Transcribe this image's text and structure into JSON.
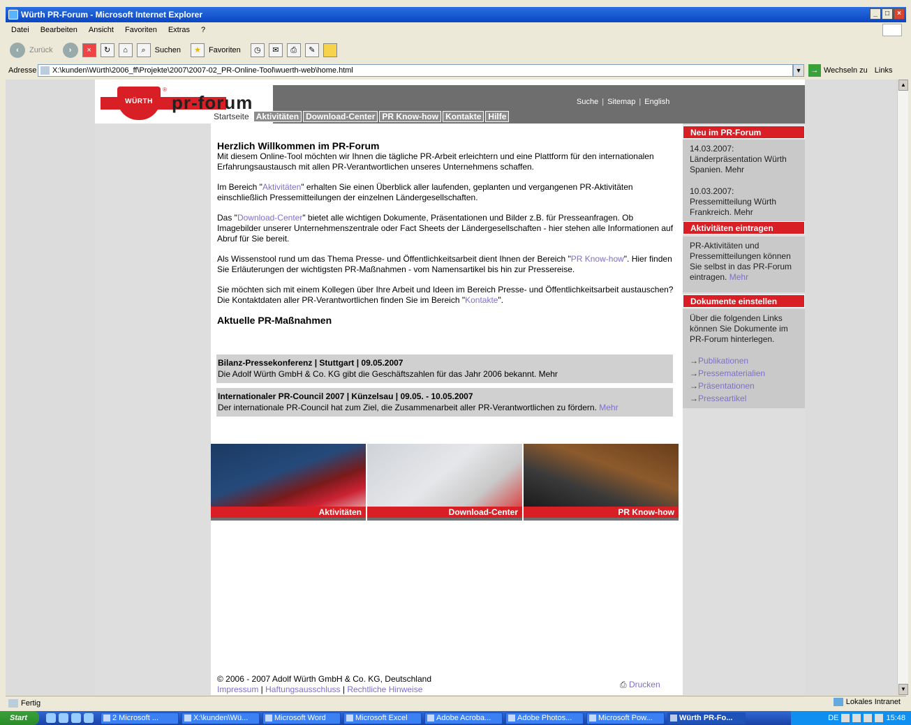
{
  "window": {
    "title": "Würth PR-Forum - Microsoft Internet Explorer"
  },
  "menu": [
    "Datei",
    "Bearbeiten",
    "Ansicht",
    "Favoriten",
    "Extras",
    "?"
  ],
  "toolbar": {
    "back": "Zurück",
    "search": "Suchen",
    "favorites": "Favoriten"
  },
  "address": {
    "label": "Adresse",
    "value": "X:\\kunden\\Würth\\2006_ff\\Projekte\\2007\\2007-02_PR-Online-Tool\\wuerth-web\\home.html",
    "go": "Wechseln zu",
    "links": "Links"
  },
  "header": {
    "logo_text": "WÜRTH",
    "brand": "pr-forum",
    "top_links": [
      "Suche",
      "Sitemap",
      "English"
    ]
  },
  "nav": [
    "Startseite",
    "Aktivitäten",
    "Download-Center",
    "PR Know-how",
    "Kontakte",
    "Hilfe"
  ],
  "main": {
    "heading": "Herzlich Willkommen im PR-Forum",
    "p1": "Mit diesem Online-Tool möchten wir Ihnen die tägliche PR-Arbeit erleichtern und eine Plattform für den internationalen Erfahrungsaustausch mit allen PR-Verantwortlichen unseres Unternehmens schaffen.",
    "p2_a": "Im Bereich \"",
    "p2_link": "Aktivitäten",
    "p2_b": "\" erhalten Sie einen Überblick aller laufenden, geplanten und vergangenen PR-Aktivitäten einschließlich Pressemitteilungen der einzelnen Ländergesellschaften.",
    "p3_a": "Das \"",
    "p3_link": "Download-Center",
    "p3_b": "\" bietet alle wichtigen Dokumente, Präsentationen und Bilder z.B. für Presseanfragen. Ob Imagebilder unserer Unternehmenszentrale oder Fact Sheets der Ländergesellschaften - hier stehen alle Informationen auf Abruf für Sie bereit.",
    "p4_a": "Als Wissenstool rund um das Thema Presse- und Öffentlichkeitsarbeit dient Ihnen der Bereich \"",
    "p4_link": "PR Know-how",
    "p4_b": "\". Hier finden Sie Erläuterungen der wichtigsten PR-Maßnahmen - vom Namensartikel bis hin zur Pressereise.",
    "p5_a": "Sie möchten sich mit einem Kollegen über Ihre Arbeit und Ideen im Bereich Presse- und Öffentlichkeitsarbeit austauschen? Die Kontaktdaten aller PR-Verantwortlichen finden Sie im Bereich \"",
    "p5_link": "Kontakte",
    "p5_b": "\".",
    "subheading": "Aktuelle PR-Maßnahmen"
  },
  "news": [
    {
      "title": "Bilanz-Pressekonferenz | Stuttgart | 09.05.2007",
      "text": "Die Adolf Würth GmbH & Co. KG gibt die Geschäftszahlen für das Jahr 2006 bekannt. Mehr",
      "more": ""
    },
    {
      "title": "Internationaler PR-Council 2007 | Künzelsau | 09.05. - 10.05.2007",
      "text": "Der internationale PR-Council hat zum Ziel, die Zusammenarbeit aller PR-Verantwortlichen zu fördern.",
      "more": "Mehr"
    }
  ],
  "banners": [
    "Aktivitäten",
    "Download-Center",
    "PR Know-how"
  ],
  "sidebar": {
    "box1": {
      "title": "Neu im PR-Forum",
      "item1_date": "14.03.2007:",
      "item1_text": "Länderpräsentation Würth Spanien. Mehr",
      "item2_date": "10.03.2007:",
      "item2_text": "Pressemitteilung Würth Frankreich. Mehr"
    },
    "box2": {
      "title": "Aktivitäten eintragen",
      "text": "PR-Aktivitäten und Pressemitteilungen können Sie selbst in das PR-Forum eintragen.",
      "more": "Mehr"
    },
    "box3": {
      "title": "Dokumente einstellen",
      "text": "Über die folgenden Links können Sie Dokumente im PR-Forum hinterlegen.",
      "links": [
        "Publikationen",
        "Pressematerialien",
        "Präsentationen",
        "Presseartikel"
      ]
    }
  },
  "footer": {
    "copyright": "© 2006 - 2007 Adolf Würth GmbH & Co. KG, Deutschland",
    "links": [
      "Impressum",
      "Haftungsausschluss",
      "Rechtliche Hinweise"
    ],
    "print": "Drucken"
  },
  "status": {
    "text": "Fertig",
    "zone": "Lokales Intranet"
  },
  "taskbar": {
    "start": "Start",
    "tasks": [
      "2 Microsoft ...",
      "X:\\kunden\\Wü...",
      "Microsoft Word",
      "Microsoft Excel",
      "Adobe Acroba...",
      "Adobe Photos...",
      "Microsoft Pow...",
      "Würth PR-Fo..."
    ],
    "lang": "DE",
    "clock": "15:48"
  }
}
